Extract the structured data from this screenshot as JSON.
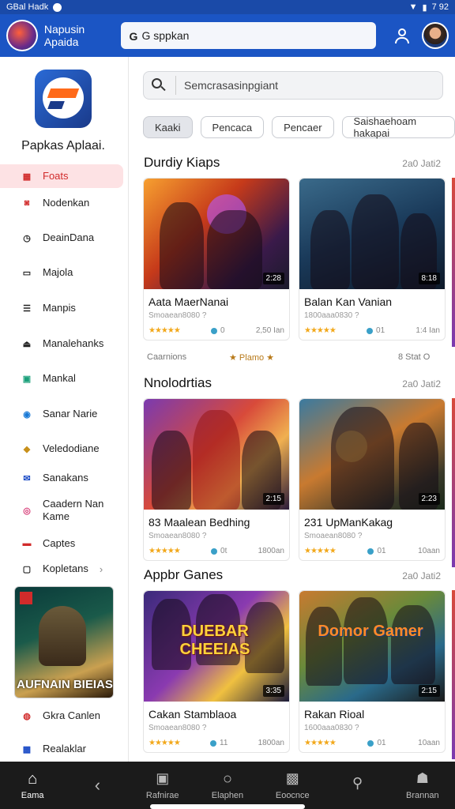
{
  "status_bar": {
    "left_text": "GBal Hadk",
    "right_text": "7 92"
  },
  "header": {
    "title": "Napusin Apaida",
    "search_value": "G sppkan"
  },
  "sidebar": {
    "app_name": "Papkas Aplaai.",
    "items": [
      {
        "label": "Foats",
        "icon": "grid-icon",
        "active": true
      },
      {
        "label": "Nodenkan",
        "icon": "gamepad-icon"
      },
      {
        "label": "DeainDana",
        "icon": "clock-icon"
      },
      {
        "label": "Majola",
        "icon": "folder-icon"
      },
      {
        "label": "Manpis",
        "icon": "list-icon"
      },
      {
        "label": "Manalehanks",
        "icon": "hat-icon"
      },
      {
        "label": "Mankal",
        "icon": "briefcase-icon"
      },
      {
        "label": "Sanar Narie",
        "icon": "globe-icon"
      },
      {
        "label": "Veledodiane",
        "icon": "puzzle-icon"
      },
      {
        "label": "Sanakans",
        "icon": "mail-icon"
      },
      {
        "label": "Caadern Nan Kame",
        "icon": "camera-icon"
      },
      {
        "label": "Captes",
        "icon": "badge-icon"
      },
      {
        "label": "Kopletans",
        "icon": "chat-icon"
      }
    ],
    "banner_title": "AUFNAIN BIEIAS",
    "bottom_items": [
      {
        "label": "Gkra Canlen",
        "icon": "chat-bubble-icon"
      },
      {
        "label": "Realaklar",
        "icon": "photo-icon"
      }
    ]
  },
  "main": {
    "search_placeholder": "Semcrasasinpgiant",
    "chips": [
      {
        "label": "Kaaki",
        "active": true
      },
      {
        "label": "Pencaca"
      },
      {
        "label": "Pencaer"
      },
      {
        "label": "Saishaehoam hakapai"
      }
    ],
    "sections": [
      {
        "title": "Durdiy Kiaps",
        "more": "2a0 Jati2",
        "cards": [
          {
            "title": "Aata MaerNanai",
            "sub": "Smoaean8080 ?",
            "stars": "★★★★★",
            "views": "0",
            "count": "2,50 Ian",
            "duration": "2:28"
          },
          {
            "title": "Balan Kan Vanian",
            "sub": "1800aaa0830 ?",
            "stars": "★★★★★",
            "views": "01",
            "count": "1:4 Ian",
            "duration": "8:18"
          }
        ],
        "below_left": "Caarnions",
        "below_mid": "★ Plamo ★",
        "below_right": "8 Stat O"
      },
      {
        "title": "Nnolodrtias",
        "more": "2a0 Jati2",
        "cards": [
          {
            "title": "83 Maalean Bedhing",
            "sub": "Smoaean8080 ?",
            "stars": "★★★★★",
            "views": "0t",
            "count": "1800an",
            "duration": "2:15"
          },
          {
            "title": "231 UpManKakag",
            "sub": "Smoaean8080 ?",
            "stars": "★★★★★",
            "views": "01",
            "count": "10aan",
            "duration": "2:23"
          }
        ]
      },
      {
        "title": "Appbr Ganes",
        "more": "2a0 Jati2",
        "cards": [
          {
            "title": "Cakan Stamblaoa",
            "sub": "Smoaean8080 ?",
            "stars": "★★★★★",
            "views": "11",
            "count": "1800an",
            "duration": "3:35",
            "art_text": "DUEBAR CHEEIAS"
          },
          {
            "title": "Rakan Rioal",
            "sub": "1600aaa0830 ?",
            "stars": "★★★★★",
            "views": "01",
            "count": "10aan",
            "duration": "2:15",
            "art_text": "Domor Gamer"
          }
        ]
      }
    ]
  },
  "bottom_nav": [
    {
      "label": "Eama",
      "icon": "home-icon",
      "active": true
    },
    {
      "label": "",
      "icon": "back-arrow-icon"
    },
    {
      "label": "Rafnirae",
      "icon": "bookmark-icon"
    },
    {
      "label": "Elaphen",
      "icon": "circle-icon"
    },
    {
      "label": "Eoocnce",
      "icon": "image-icon"
    },
    {
      "label": "",
      "icon": "search-tool-icon"
    },
    {
      "label": "Brannan",
      "icon": "profile-icon"
    }
  ],
  "colors": {
    "header_blue": "#1b55c4",
    "active_red": "#d12b2b",
    "nav_dark": "#1b1b1b"
  }
}
